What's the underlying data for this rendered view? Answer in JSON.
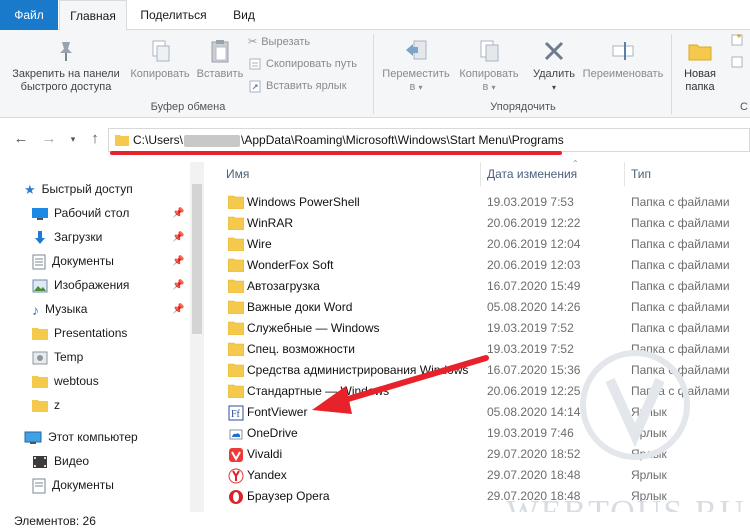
{
  "tabs": {
    "file": "Файл",
    "home": "Главная",
    "share": "Поделиться",
    "view": "Вид"
  },
  "ribbon": {
    "pin_line1": "Закрепить на панели",
    "pin_line2": "быстрого доступа",
    "copy": "Копировать",
    "paste": "Вставить",
    "cut": "Вырезать",
    "copy_path": "Скопировать путь",
    "paste_shortcut": "Вставить ярлык",
    "clipboard_group": "Буфер обмена",
    "move_to_line1": "Переместить",
    "move_to_line2": "в",
    "copy_to_line1": "Копировать",
    "copy_to_line2": "в",
    "delete": "Удалить",
    "rename": "Переименовать",
    "organize_group": "Упорядочить",
    "new_folder_line1": "Новая",
    "new_folder_line2": "папка",
    "new_group_fragment": "С"
  },
  "address": {
    "part_before": "C:\\Users\\",
    "part_after": "\\AppData\\Roaming\\Microsoft\\Windows\\Start Menu\\Programs"
  },
  "nav": {
    "quick_access": "Быстрый доступ",
    "items": [
      {
        "label": "Рабочий стол",
        "icon": "desktop-icon"
      },
      {
        "label": "Загрузки",
        "icon": "download-icon"
      },
      {
        "label": "Документы",
        "icon": "documents-icon"
      },
      {
        "label": "Изображения",
        "icon": "pictures-icon"
      },
      {
        "label": "Музыка",
        "icon": "music-icon"
      },
      {
        "label": "Presentations",
        "icon": "folder-icon"
      },
      {
        "label": "Temp",
        "icon": "temp-icon"
      },
      {
        "label": "webtous",
        "icon": "folder-icon"
      },
      {
        "label": "z",
        "icon": "folder-icon"
      }
    ],
    "this_pc": "Этот компьютер",
    "pc_items": [
      {
        "label": "Видео",
        "icon": "video-icon"
      },
      {
        "label": "Документы",
        "icon": "documents-icon"
      }
    ]
  },
  "columns": {
    "name": "Имя",
    "date": "Дата изменения",
    "type": "Тип"
  },
  "files": [
    {
      "name": "Windows PowerShell",
      "date": "19.03.2019 7:53",
      "type": "Папка с файлами",
      "icon": "folder-icon"
    },
    {
      "name": "WinRAR",
      "date": "20.06.2019 12:22",
      "type": "Папка с файлами",
      "icon": "folder-icon"
    },
    {
      "name": "Wire",
      "date": "20.06.2019 12:04",
      "type": "Папка с файлами",
      "icon": "folder-icon"
    },
    {
      "name": "WonderFox Soft",
      "date": "20.06.2019 12:03",
      "type": "Папка с файлами",
      "icon": "folder-icon"
    },
    {
      "name": "Автозагрузка",
      "date": "16.07.2020 15:49",
      "type": "Папка с файлами",
      "icon": "folder-icon"
    },
    {
      "name": "Важные доки Word",
      "date": "05.08.2020 14:26",
      "type": "Папка с файлами",
      "icon": "folder-icon"
    },
    {
      "name": "Служебные — Windows",
      "date": "19.03.2019 7:52",
      "type": "Папка с файлами",
      "icon": "folder-icon"
    },
    {
      "name": "Спец. возможности",
      "date": "19.03.2019 7:52",
      "type": "Папка с файлами",
      "icon": "folder-icon"
    },
    {
      "name": "Средства администрирования Windows",
      "date": "16.07.2020 15:36",
      "type": "Папка с файлами",
      "icon": "folder-icon"
    },
    {
      "name": "Стандартные — Windows",
      "date": "20.06.2019 12:25",
      "type": "Папка с файлами",
      "icon": "folder-icon"
    },
    {
      "name": "FontViewer",
      "date": "05.08.2020 14:14",
      "type": "Ярлык",
      "icon": "fontviewer-icon"
    },
    {
      "name": "OneDrive",
      "date": "19.03.2019 7:46",
      "type": "Ярлык",
      "icon": "onedrive-icon"
    },
    {
      "name": "Vivaldi",
      "date": "29.07.2020 18:52",
      "type": "Ярлык",
      "icon": "vivaldi-icon"
    },
    {
      "name": "Yandex",
      "date": "29.07.2020 18:48",
      "type": "Ярлык",
      "icon": "yandex-icon"
    },
    {
      "name": "Браузер Opera",
      "date": "29.07.2020 18:48",
      "type": "Ярлык",
      "icon": "opera-icon"
    }
  ],
  "status": {
    "items_count": "Элементов: 26"
  },
  "watermark": "WEBTOUS.RU",
  "colors": {
    "file_tab": "#1979ca",
    "folder": "#f5c94c",
    "annotation_red": "#e8222a",
    "header_text": "#4c607a"
  }
}
